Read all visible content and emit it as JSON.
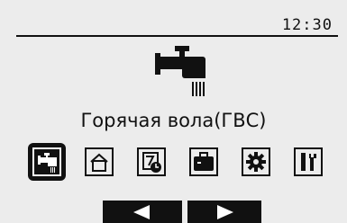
{
  "header": {
    "clock": "12:30"
  },
  "main": {
    "icon": "hot-water-tap-icon",
    "title": "Горячая вола(ГВС)"
  },
  "menu": {
    "items": [
      {
        "icon": "hot-water-tap-icon",
        "active": true
      },
      {
        "icon": "house-icon",
        "active": false
      },
      {
        "icon": "schedule-timer-icon",
        "active": false
      },
      {
        "icon": "holiday-suitcase-icon",
        "active": false
      },
      {
        "icon": "settings-gear-icon",
        "active": false
      },
      {
        "icon": "service-tools-icon",
        "active": false
      }
    ]
  },
  "navigation": {
    "prev_icon": "arrow-left-icon",
    "next_icon": "arrow-right-icon"
  }
}
